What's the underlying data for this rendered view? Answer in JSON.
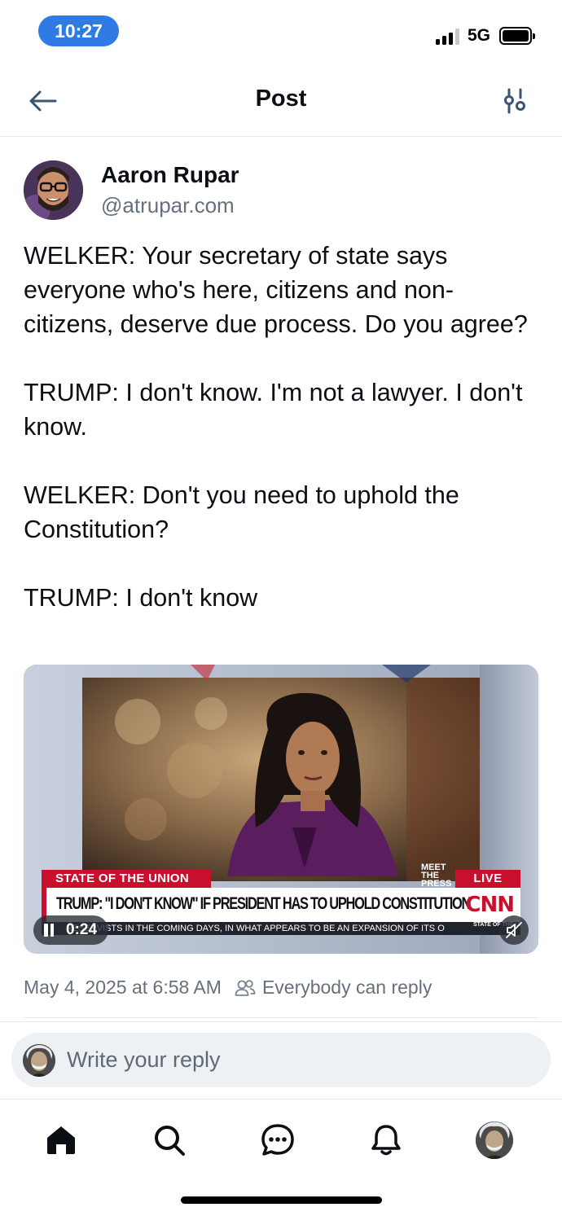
{
  "status_bar": {
    "time": "10:27",
    "network": "5G"
  },
  "header": {
    "title": "Post"
  },
  "author": {
    "name": "Aaron Rupar",
    "handle": "@atrupar.com"
  },
  "post": {
    "paragraphs": [
      "WELKER: Your secretary of state says everyone who's here, citizens and non-citizens, deserve due process. Do you agree?",
      "TRUMP: I don't know. I'm not a lawyer. I don't know.",
      "WELKER: Don't you need to uphold the Constitution?",
      "TRUMP: I don't know"
    ]
  },
  "video": {
    "show_label": "STATE OF THE UNION",
    "meet_badge": "MEET THE PRESS",
    "live_label": "LIVE",
    "headline": "TRUMP: \"I DON'T KNOW\" IF PRESIDENT HAS TO UPHOLD CONSTITUTION",
    "network_logo": "CNN",
    "ticker": "RESERVISTS IN THE COMING DAYS, IN WHAT APPEARS TO BE AN EXPANSION OF ITS O",
    "ticker_brand": "STATE OF THE UNION",
    "elapsed": "0:24"
  },
  "meta": {
    "timestamp": "May 4, 2025 at 6:58 AM",
    "reply_setting": "Everybody can reply"
  },
  "reply": {
    "placeholder": "Write your reply"
  },
  "tabs": [
    "home-tab",
    "search-tab",
    "chat-tab",
    "notifications-tab",
    "profile-tab"
  ],
  "colors": {
    "accent": "#2f7ae5",
    "text": "#0b0f14",
    "muted": "#66707c",
    "cnn_red": "#c8102e"
  }
}
